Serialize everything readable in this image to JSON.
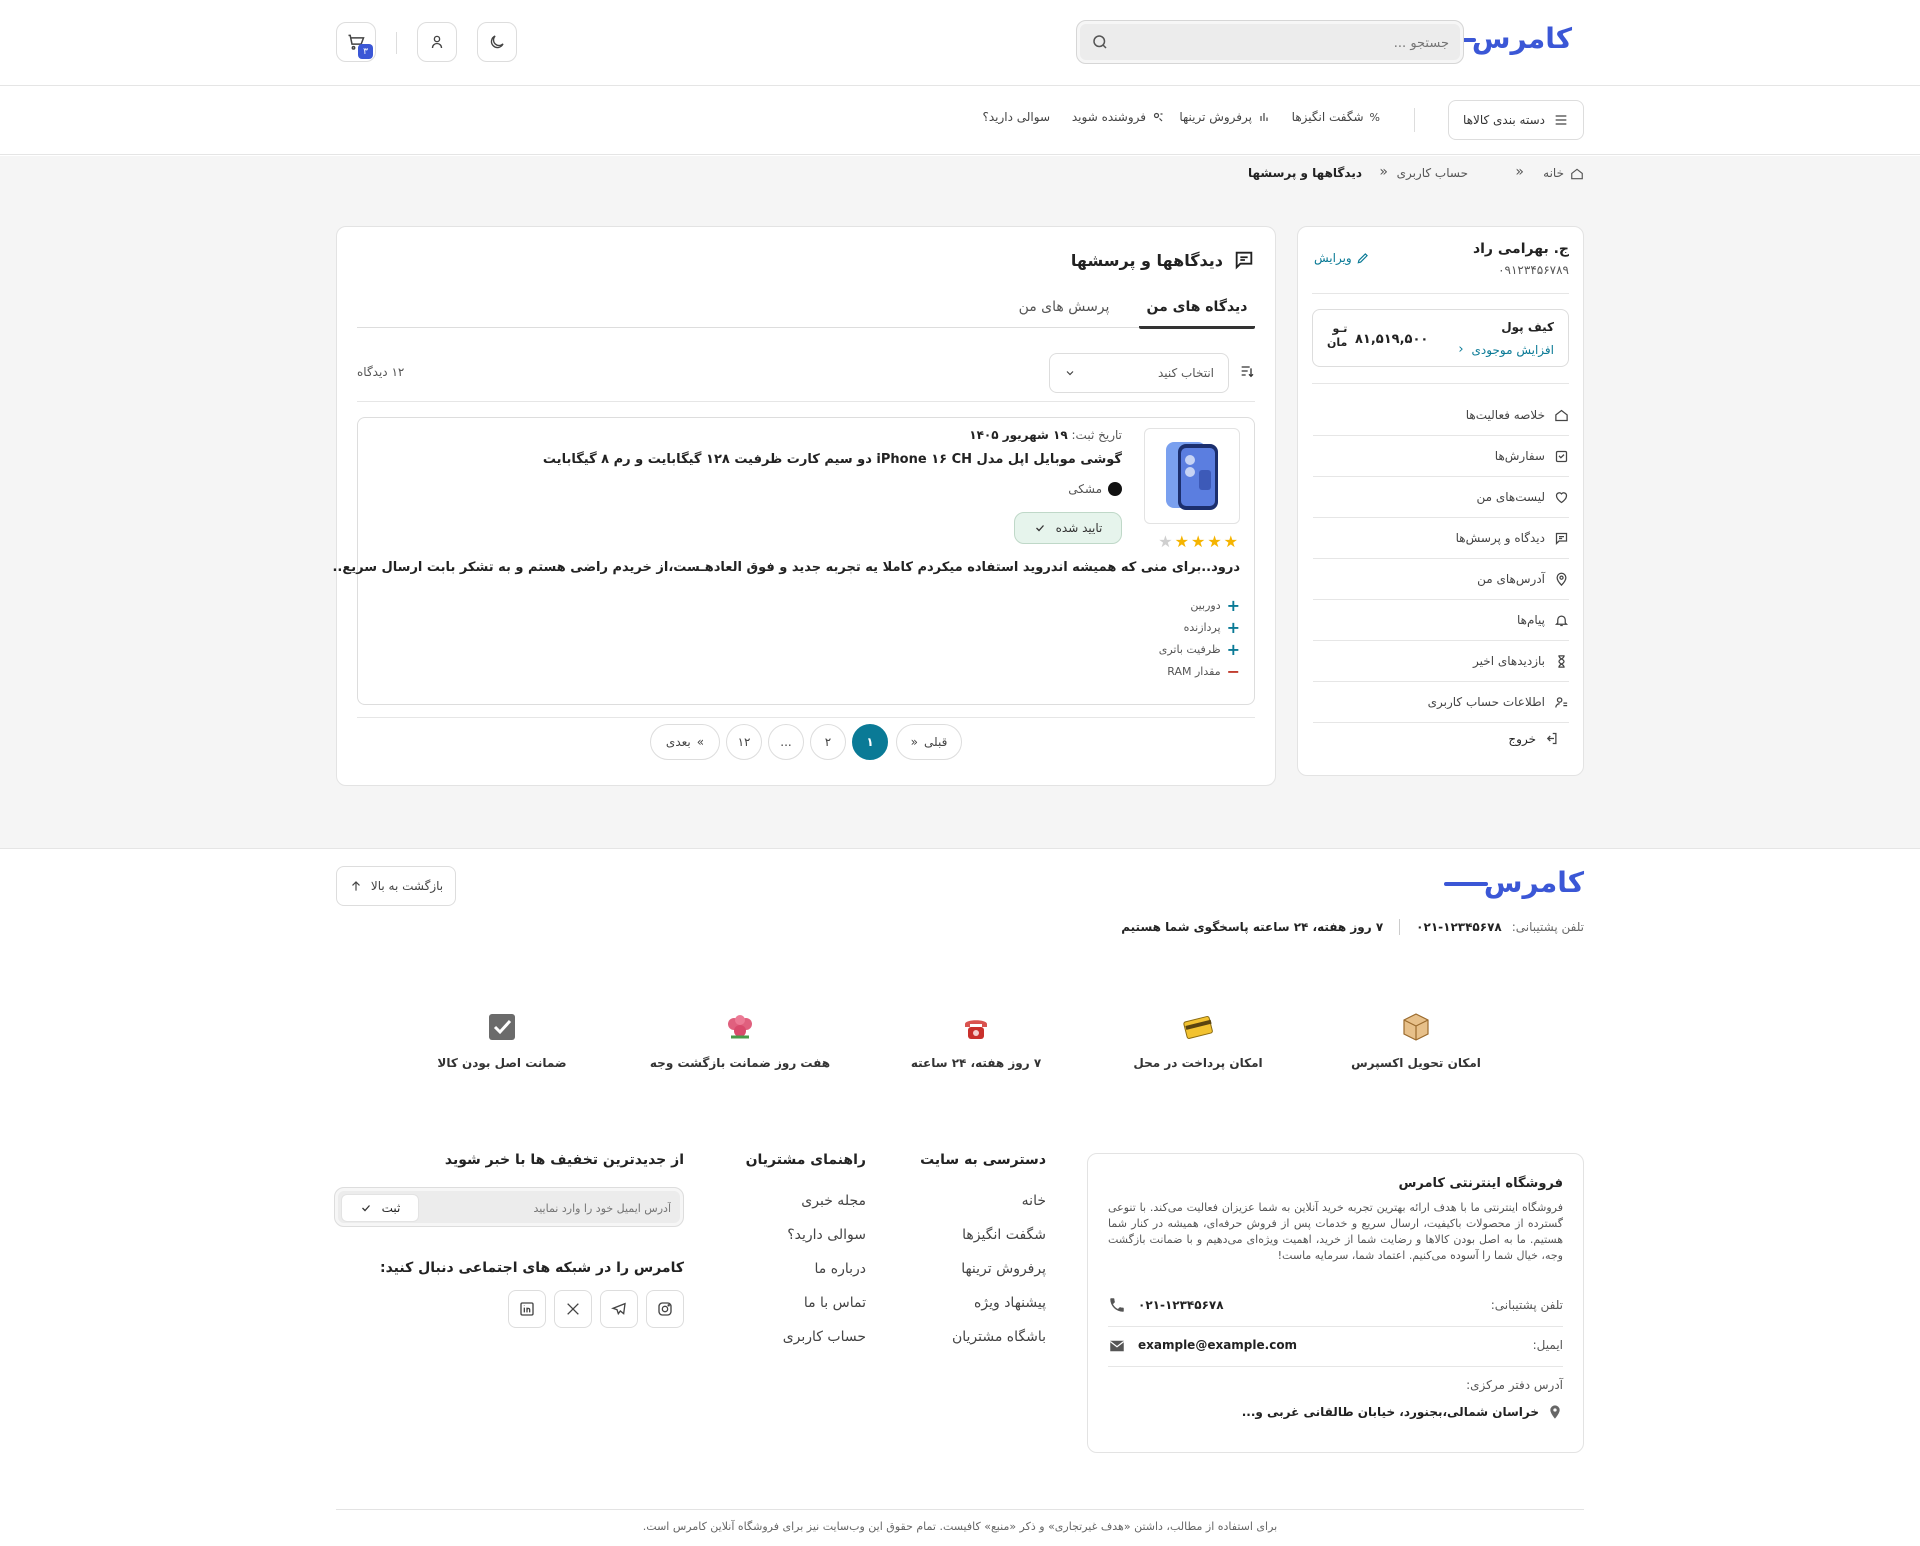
{
  "header": {
    "logo": "کامرس",
    "search_placeholder": "جستجو ...",
    "cart_count": "۳"
  },
  "nav": {
    "categories": "دسته بندی کالاها",
    "links": [
      "شگفت انگیزها",
      "پرفروش ترینها",
      "فروشنده شوید",
      "سوالی دارید؟"
    ]
  },
  "breadcrumb": {
    "home": "خانه",
    "account": "حساب کاربری",
    "current": "دیدگاهها و پرسشها"
  },
  "profile": {
    "name": "ج. بهرامی راد",
    "phone": "۰۹۱۲۳۴۵۶۷۸۹",
    "edit": "ویرایش",
    "wallet_label": "کیف پول",
    "wallet_amount": "۸۱,۵۱۹,۵۰۰",
    "wallet_unit_1": "تـو",
    "wallet_unit_2": "مان",
    "wallet_topup": "افزایش موجودی",
    "menu": [
      "خلاصه فعالیت‌ها",
      "سفارش‌ها",
      "لیست‌های من",
      "دیدگاه و پرسش‌ها",
      "آدرس‌های من",
      "پیام‌ها",
      "بازدیدهای اخیر",
      "اطلاعات حساب کاربری"
    ],
    "logout": "خروج"
  },
  "reviews": {
    "title": "دیدگاهها و پرسشها",
    "tab_reviews": "دیدگاه های من",
    "tab_questions": "پرسش های من",
    "select_placeholder": "انتخاب کنید",
    "count_text": "۱۲ دیدگاه",
    "item": {
      "date_label": "تاریخ ثبت:",
      "date": "۱۹ شهریور ۱۴۰۵",
      "product": "گوشی موبایل اپل مدل iPhone ۱۶ CH دو سیم کارت ظرفیت ۱۲۸ گیگابایت و رم ۸ گیگابایت",
      "color": "مشکی",
      "status": "تایید شده",
      "rating": 4,
      "rating_max": 5,
      "text": "درود..برای منی که همیشه اندروید استفاده میکردم کاملا یه تجربه جدید و فوق العادهـست،از خریدم راضی هستم و به تشکر بابت ارسال سریع..",
      "pros": [
        "دوربین",
        "پردازنده",
        "ظرفیت باتری"
      ],
      "cons": [
        "مقدار RAM"
      ]
    },
    "pagination": {
      "prev": "قبلی",
      "next": "بعدی",
      "pages": [
        "۱",
        "۲",
        "...",
        "۱۲"
      ]
    }
  },
  "footer": {
    "logo": "کامرس",
    "back_to_top": "بازگشت به بالا",
    "support_label": "تلفن پشتیبانی:",
    "support_phone": "۰۲۱-۱۲۳۴۵۶۷۸",
    "support_hours": "۷ روز هفته، ۲۴ ساعته پاسخگوی شما هستیم",
    "features": [
      {
        "label": "امکان تحویل اکسپرس",
        "icon": "box-icon"
      },
      {
        "label": "امکان پرداخت در محل",
        "icon": "card-icon"
      },
      {
        "label": "۷ روز هفته، ۲۴ ساعته",
        "icon": "phone-icon"
      },
      {
        "label": "هفت روز ضمانت بازگشت وجه",
        "icon": "flower-icon"
      },
      {
        "label": "ضمانت اصل بودن کالا",
        "icon": "check-icon"
      }
    ],
    "about_title": "فروشگاه اینترنتی کامرس",
    "about_text": "فروشگاه اینترنتی ما با هدف ارائه بهترین تجربه خرید آنلاین به شما عزیزان فعالیت می‌کند. با تنوعی گسترده از محصولات باکیفیت، ارسال سریع و خدمات پس از فروش حرفه‌ای، همیشه در کنار شما هستیم. ما به اصل بودن کالاها و رضایت شما از خرید، اهمیت ویژه‌ای می‌دهیم و با ضمانت بازگشت وجه، خیال شما را آسوده می‌کنیم. اعتماد شما، سرمایه ماست!",
    "contact_phone_label": "تلفن پشتیبانی:",
    "contact_phone": "۰۲۱-۱۲۳۴۵۶۷۸",
    "contact_email_label": "ایمیل:",
    "contact_email": "example@example.com",
    "address_label": "آدرس دفتر مرکزی:",
    "address": "خراسان شمالی،بجنورد، خیابان طالقانی غربی و...",
    "col_site_title": "دسترسی به سایت",
    "col_site_links": [
      "خانه",
      "شگفت انگیزها",
      "پرفروش ترینها",
      "پیشنهاد ویژه",
      "باشگاه مشتریان"
    ],
    "col_guide_title": "راهنمای مشتریان",
    "col_guide_links": [
      "مجله خبری",
      "سوالی دارید؟",
      "درباره ما",
      "تماس با ما",
      "حساب کاربری"
    ],
    "newsletter_title": "از جدیدترین تخفیف ها با خبر شوید",
    "newsletter_placeholder": "آدرس ایمیل خود را وارد نمایید",
    "newsletter_submit": "ثبت",
    "social_title": "کامرس را در شبکه های اجتماعی دنبال کنید:",
    "copyright": "برای استفاده از مطالب، داشتن «هدف غیرتجاری» و ذکر «منبع» کافیست. تمام حقوق این وب‌سایت نیز برای فروشگاه آنلاین کامرس است."
  },
  "colors": {
    "brand": "#3b57d6",
    "accent": "#0a7a96",
    "star": "#f5b400",
    "success_bg": "#e6f4ec"
  }
}
